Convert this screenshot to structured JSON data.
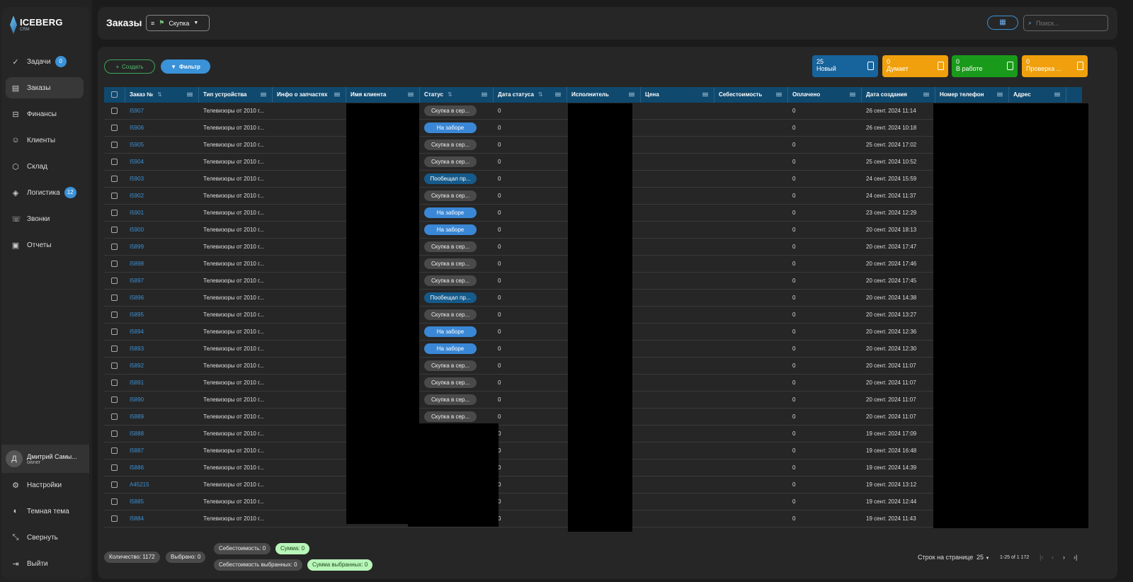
{
  "app": {
    "name": "ICEBERG",
    "sub": "CRM"
  },
  "nav": [
    {
      "label": "Задачи",
      "icon": "✓",
      "badge": "0"
    },
    {
      "label": "Заказы",
      "icon": "▤",
      "active": true
    },
    {
      "label": "Финансы",
      "icon": "⊟"
    },
    {
      "label": "Клиенты",
      "icon": "☺"
    },
    {
      "label": "Склад",
      "icon": "⬡"
    },
    {
      "label": "Логистика",
      "icon": "◈",
      "badge": "12"
    },
    {
      "label": "Звонки",
      "icon": "☏"
    },
    {
      "label": "Отчеты",
      "icon": "▣"
    }
  ],
  "user": {
    "initial": "Д",
    "name": "Дмитрий Самы...",
    "role": "owner"
  },
  "bottom_nav": [
    {
      "label": "Настройки",
      "icon": "⚙"
    },
    {
      "label": "Темная тема",
      "icon": "◐"
    },
    {
      "label": "Свернуть",
      "icon": "⤡"
    },
    {
      "label": "Выйти",
      "icon": "⇥"
    }
  ],
  "header": {
    "title": "Заказы",
    "view": "Скупка",
    "search_placeholder": "Поиск..."
  },
  "toolbar": {
    "create": "Создать",
    "filter": "Фильтр"
  },
  "stat_cards": [
    {
      "count": "25",
      "label": "Новый",
      "color": "#17639c"
    },
    {
      "count": "0",
      "label": "Думает",
      "color": "#f0a00c"
    },
    {
      "count": "0",
      "label": "В работе",
      "color": "#1a9a1a"
    },
    {
      "count": "0",
      "label": "Проверка ...",
      "color": "#f0a00c"
    }
  ],
  "columns": [
    "Заказ №",
    "Тип устройства",
    "Инфо о запчастях",
    "Имя клиента",
    "Статус",
    "Дата статуса",
    "Исполнитель",
    "Цена",
    "Себестоимость",
    "Оплачено",
    "Дата создания",
    "Номер телефон",
    "Адрес"
  ],
  "rows": [
    {
      "id": "I5907",
      "device": "Телевизоры от 2010 г...",
      "status": "Скупка в сер...",
      "kind": "gray",
      "date_status": "0",
      "paid": "0",
      "created": "26 сент. 2024 11:14"
    },
    {
      "id": "I5906",
      "device": "Телевизоры от 2010 г...",
      "status": "На заборе",
      "kind": "blue",
      "date_status": "0",
      "paid": "0",
      "created": "26 сент. 2024 10:18"
    },
    {
      "id": "I5905",
      "device": "Телевизоры от 2010 г...",
      "status": "Скупка в сер...",
      "kind": "gray",
      "date_status": "0",
      "paid": "0",
      "created": "25 сент. 2024 17:02"
    },
    {
      "id": "I5904",
      "device": "Телевизоры от 2010 г...",
      "status": "Скупка в сер...",
      "kind": "gray",
      "date_status": "0",
      "paid": "0",
      "created": "25 сент. 2024 10:52"
    },
    {
      "id": "I5903",
      "device": "Телевизоры от 2010 г...",
      "status": "Пообещал пр...",
      "kind": "dark",
      "date_status": "0",
      "paid": "0",
      "created": "24 сент. 2024 15:59"
    },
    {
      "id": "I5902",
      "device": "Телевизоры от 2010 г...",
      "status": "Скупка в сер...",
      "kind": "gray",
      "date_status": "0",
      "paid": "0",
      "created": "24 сент. 2024 11:37"
    },
    {
      "id": "I5901",
      "device": "Телевизоры от 2010 г...",
      "status": "На заборе",
      "kind": "blue",
      "date_status": "0",
      "paid": "0",
      "created": "23 сент. 2024 12:29"
    },
    {
      "id": "I5900",
      "device": "Телевизоры от 2010 г...",
      "status": "На заборе",
      "kind": "blue",
      "date_status": "0",
      "paid": "0",
      "created": "20 сент. 2024 18:13"
    },
    {
      "id": "I5899",
      "device": "Телевизоры от 2010 г...",
      "status": "Скупка в сер...",
      "kind": "gray",
      "date_status": "0",
      "paid": "0",
      "created": "20 сент. 2024 17:47"
    },
    {
      "id": "I5898",
      "device": "Телевизоры от 2010 г...",
      "status": "Скупка в сер...",
      "kind": "gray",
      "date_status": "0",
      "paid": "0",
      "created": "20 сент. 2024 17:46"
    },
    {
      "id": "I5897",
      "device": "Телевизоры от 2010 г...",
      "status": "Скупка в сер...",
      "kind": "gray",
      "date_status": "0",
      "paid": "0",
      "created": "20 сент. 2024 17:45"
    },
    {
      "id": "I5896",
      "device": "Телевизоры от 2010 г...",
      "status": "Пообещал пр...",
      "kind": "dark",
      "date_status": "0",
      "paid": "0",
      "created": "20 сент. 2024 14:38"
    },
    {
      "id": "I5895",
      "device": "Телевизоры от 2010 г...",
      "status": "Скупка в сер...",
      "kind": "gray",
      "date_status": "0",
      "paid": "0",
      "created": "20 сент. 2024 13:27"
    },
    {
      "id": "I5894",
      "device": "Телевизоры от 2010 г...",
      "status": "На заборе",
      "kind": "blue",
      "date_status": "0",
      "paid": "0",
      "created": "20 сент. 2024 12:36"
    },
    {
      "id": "I5893",
      "device": "Телевизоры от 2010 г...",
      "status": "На заборе",
      "kind": "blue",
      "date_status": "0",
      "paid": "0",
      "created": "20 сент. 2024 12:30"
    },
    {
      "id": "I5892",
      "device": "Телевизоры от 2010 г...",
      "status": "Скупка в сер...",
      "kind": "gray",
      "date_status": "0",
      "paid": "0",
      "created": "20 сент. 2024 11:07"
    },
    {
      "id": "I5891",
      "device": "Телевизоры от 2010 г...",
      "status": "Скупка в сер...",
      "kind": "gray",
      "date_status": "0",
      "paid": "0",
      "created": "20 сент. 2024 11:07"
    },
    {
      "id": "I5890",
      "device": "Телевизоры от 2010 г...",
      "status": "Скупка в сер...",
      "kind": "gray",
      "date_status": "0",
      "paid": "0",
      "created": "20 сент. 2024 11:07"
    },
    {
      "id": "I5889",
      "device": "Телевизоры от 2010 г...",
      "status": "Скупка в сер...",
      "kind": "gray",
      "date_status": "0",
      "paid": "0",
      "created": "20 сент. 2024 11:07"
    },
    {
      "id": "I5888",
      "device": "Телевизоры от 2010 г...",
      "status": "",
      "kind": "",
      "date_status": "0",
      "paid": "0",
      "created": "19 сент. 2024 17:09"
    },
    {
      "id": "I5887",
      "device": "Телевизоры от 2010 г...",
      "status": "",
      "kind": "",
      "date_status": "0",
      "paid": "0",
      "created": "19 сент. 2024 16:48"
    },
    {
      "id": "I5886",
      "device": "Телевизоры от 2010 г...",
      "status": "",
      "kind": "",
      "date_status": "0",
      "paid": "0",
      "created": "19 сент. 2024 14:39"
    },
    {
      "id": "A45215",
      "device": "Телевизоры от 2010 г...",
      "status": "",
      "kind": "",
      "date_status": "0",
      "paid": "0",
      "created": "19 сент. 2024 13:12"
    },
    {
      "id": "I5885",
      "device": "Телевизоры от 2010 г...",
      "status": "",
      "kind": "",
      "date_status": "0",
      "paid": "0",
      "created": "19 сент. 2024 12:44"
    },
    {
      "id": "I5884",
      "device": "Телевизоры от 2010 г...",
      "status": "",
      "kind": "",
      "date_status": "0",
      "paid": "0",
      "created": "19 сент. 2024 11:43"
    }
  ],
  "footer": {
    "count": "Количество: 1172",
    "selected": "Выбрано: 0",
    "cost": "Себестоимость: 0",
    "sum": "Сумма: 0",
    "cost_selected": "Себестоимость выбранных: 0",
    "sum_selected": "Сумма выбранных: 0",
    "rows_per_page_label": "Строк на странице",
    "rows_per_page": "25",
    "range": "1-25 of 1 172"
  }
}
